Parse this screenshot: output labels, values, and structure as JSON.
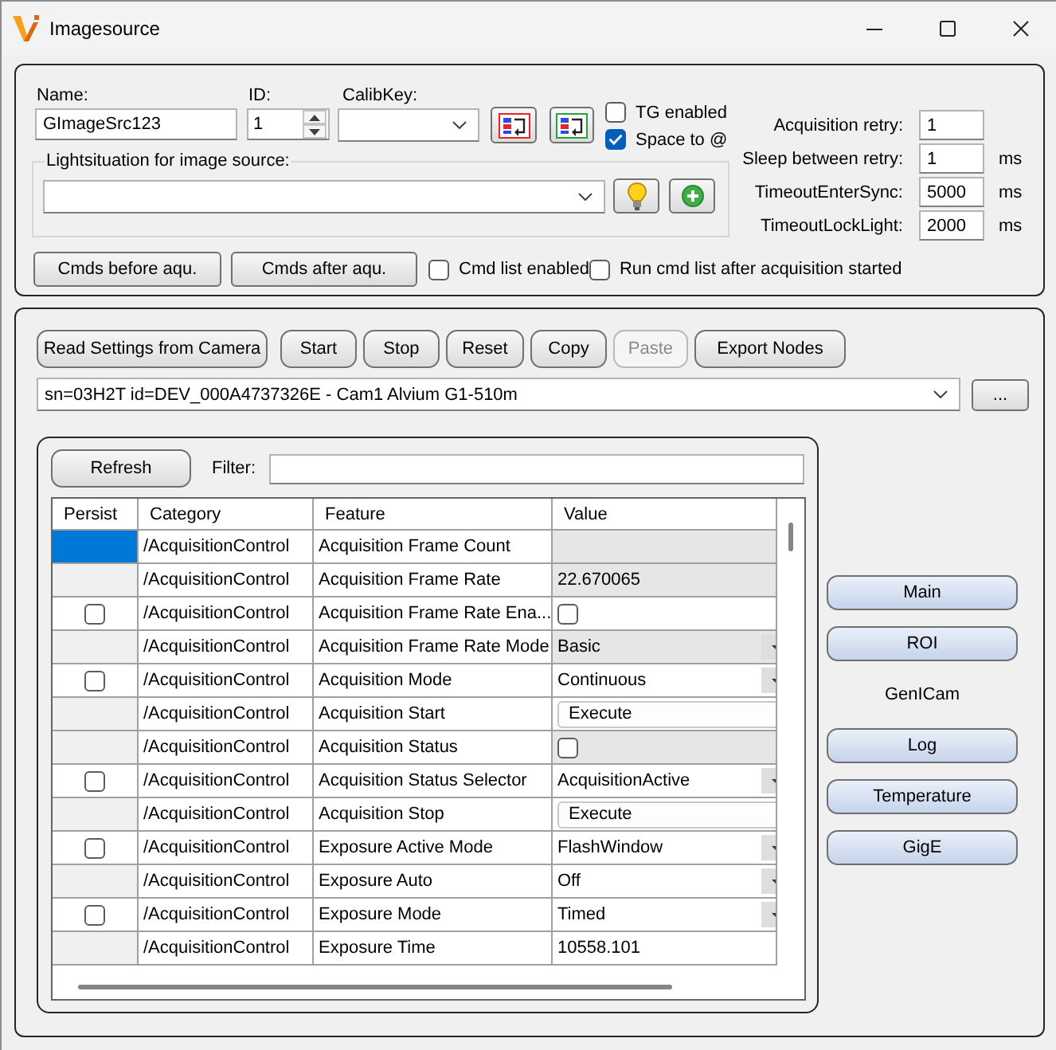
{
  "window": {
    "title": "Imagesource"
  },
  "source_panel": {
    "name_field": {
      "label": "Name:",
      "value": "GImageSrc123"
    },
    "id_field": {
      "label": "ID:",
      "value": "1"
    },
    "calib_key": {
      "label": "CalibKey:"
    },
    "checkboxes": [
      {
        "label": "TG enabled",
        "checked": false
      },
      {
        "label": "Space to @",
        "checked": true
      }
    ],
    "light_situation": {
      "label": "Lightsituation for image source:"
    },
    "settings": [
      {
        "label": "Acquisition retry:",
        "value": "1"
      },
      {
        "label": "Sleep between retry:",
        "value": "1",
        "unit": "ms"
      },
      {
        "label": "TimeoutEnterSync:",
        "value": "5000",
        "unit": "ms"
      },
      {
        "label": "TimeoutLockLight:",
        "value": "2000",
        "unit": "ms"
      }
    ],
    "buttons": [
      "Cmds before aqu.",
      "Cmds after aqu."
    ],
    "options": [
      {
        "label": "Cmd list enabled",
        "checked": false
      },
      {
        "label": "Run cmd list after acquisition started",
        "checked": false
      }
    ]
  },
  "camera_panel": {
    "toolbar": [
      {
        "label": "Read Settings from Camera",
        "disabled": false
      },
      {
        "label": "Start",
        "disabled": false
      },
      {
        "label": "Stop",
        "disabled": false
      },
      {
        "label": "Reset",
        "disabled": false
      },
      {
        "label": "Copy",
        "disabled": false
      },
      {
        "label": "Paste",
        "disabled": true
      },
      {
        "label": "Export Nodes",
        "disabled": false
      }
    ],
    "device": {
      "value": "sn=03H2T id=DEV_000A4737326E - Cam1 Alvium G1-510m"
    },
    "browse_button": "...",
    "refresh_button": "Refresh",
    "filter": {
      "label": "Filter:"
    },
    "table": {
      "columns": [
        "Persist",
        "Category",
        "Feature",
        "Value"
      ],
      "rows": [
        {
          "selected": true,
          "persist": {
            "kind": "none"
          },
          "category": "/AcquisitionControl",
          "feature": "Acquisition Frame Count",
          "value": {
            "kind": "text",
            "readonly": true
          }
        },
        {
          "selected": false,
          "persist": {
            "kind": "none"
          },
          "category": "/AcquisitionControl",
          "feature": "Acquisition Frame Rate",
          "value": {
            "kind": "text",
            "text": "22.670065",
            "readonly": true
          }
        },
        {
          "selected": false,
          "persist": {
            "kind": "checkbox",
            "checked": false
          },
          "category": "/AcquisitionControl",
          "feature": "Acquisition Frame Rate Ena...",
          "value": {
            "kind": "checkbox",
            "checked": false,
            "readonly": false
          }
        },
        {
          "selected": false,
          "persist": {
            "kind": "none"
          },
          "category": "/AcquisitionControl",
          "feature": "Acquisition Frame Rate Mode",
          "value": {
            "kind": "dropdown",
            "text": "Basic",
            "readonly": true
          }
        },
        {
          "selected": false,
          "persist": {
            "kind": "checkbox",
            "checked": false
          },
          "category": "/AcquisitionControl",
          "feature": "Acquisition Mode",
          "value": {
            "kind": "dropdown",
            "text": "Continuous",
            "readonly": false
          }
        },
        {
          "selected": false,
          "persist": {
            "kind": "none"
          },
          "category": "/AcquisitionControl",
          "feature": "Acquisition Start",
          "value": {
            "kind": "button",
            "text": "Execute",
            "readonly": false
          }
        },
        {
          "selected": false,
          "persist": {
            "kind": "none"
          },
          "category": "/AcquisitionControl",
          "feature": "Acquisition Status",
          "value": {
            "kind": "checkbox",
            "checked": false,
            "readonly": true
          }
        },
        {
          "selected": false,
          "persist": {
            "kind": "checkbox",
            "checked": false
          },
          "category": "/AcquisitionControl",
          "feature": "Acquisition Status Selector",
          "value": {
            "kind": "dropdown",
            "text": "AcquisitionActive",
            "readonly": false
          }
        },
        {
          "selected": false,
          "persist": {
            "kind": "none"
          },
          "category": "/AcquisitionControl",
          "feature": "Acquisition Stop",
          "value": {
            "kind": "button",
            "text": "Execute",
            "readonly": false
          }
        },
        {
          "selected": false,
          "persist": {
            "kind": "checkbox",
            "checked": false
          },
          "category": "/AcquisitionControl",
          "feature": "Exposure Active Mode",
          "value": {
            "kind": "dropdown",
            "text": "FlashWindow",
            "readonly": false
          }
        },
        {
          "selected": false,
          "persist": {
            "kind": "none"
          },
          "category": "/AcquisitionControl",
          "feature": "Exposure Auto",
          "value": {
            "kind": "dropdown",
            "text": "Off",
            "readonly": false
          }
        },
        {
          "selected": false,
          "persist": {
            "kind": "checkbox",
            "checked": false
          },
          "category": "/AcquisitionControl",
          "feature": "Exposure Mode",
          "value": {
            "kind": "dropdown",
            "text": "Timed",
            "readonly": false
          }
        },
        {
          "selected": false,
          "persist": {
            "kind": "none"
          },
          "category": "/AcquisitionControl",
          "feature": "Exposure Time",
          "value": {
            "kind": "text",
            "text": "10558.101",
            "readonly": false
          }
        }
      ]
    },
    "side_tabs": [
      {
        "label": "Main",
        "selected": false
      },
      {
        "label": "ROI",
        "selected": false
      },
      {
        "label": "GenICam",
        "selected": true
      },
      {
        "label": "Log",
        "selected": false
      },
      {
        "label": "Temperature",
        "selected": false
      },
      {
        "label": "GigE",
        "selected": false
      }
    ]
  }
}
